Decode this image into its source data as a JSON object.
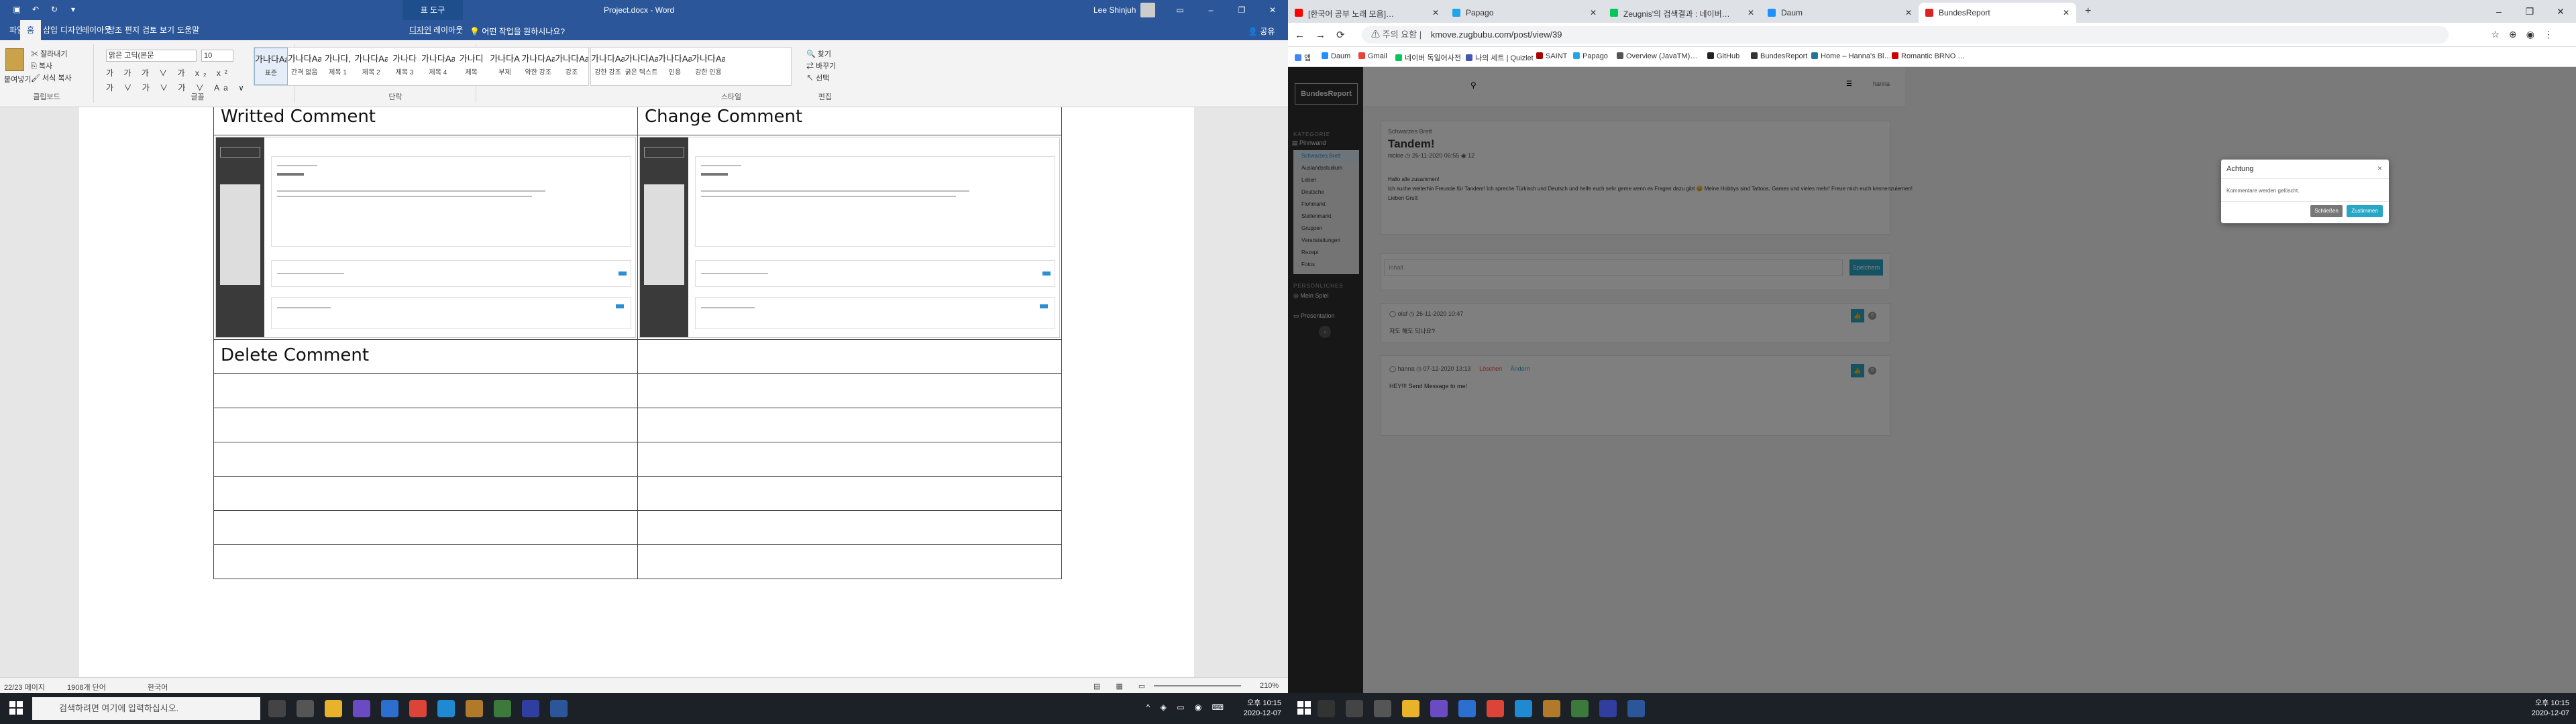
{
  "word": {
    "title": {
      "context_tab": "표 도구",
      "doc_title": "Project.docx  -  Word",
      "user": "Lee Shinjuh"
    },
    "menu_tabs": [
      "파일",
      "홈",
      "삽입",
      "디자인",
      "레이아웃",
      "참조",
      "편지",
      "검토",
      "보기",
      "도움말",
      "디자인",
      "레이아웃"
    ],
    "tell_me": "어떤 작업을 원하시나요?",
    "share": "공유",
    "ribbon": {
      "clipboard": {
        "paste": "붙여넣기",
        "cut": "잘라내기",
        "copy": "복사",
        "format_painter": "서식 복사",
        "label": "클립보드"
      },
      "font": {
        "name": "맑은 고딕(본문",
        "size": "10",
        "label": "글꼴",
        "row1": "가 가 가 ∨ 가 x₂ x²",
        "row2": "가 ∨ 가 ∨ 가 ∨ Aa ∨"
      },
      "paragraph": {
        "label": "단락"
      },
      "styles": {
        "label": "스타일",
        "items": [
          {
            "sample": "가나다AaI",
            "name": "표준"
          },
          {
            "sample": "가나다AaI",
            "name": "간격 없음"
          },
          {
            "sample": "가나다,",
            "name": "제목 1"
          },
          {
            "sample": "가나다AaI",
            "name": "제목 2"
          },
          {
            "sample": "가나다",
            "name": "제목 3"
          },
          {
            "sample": "가나다AaI",
            "name": "제목 4"
          },
          {
            "sample": "가나디",
            "name": "제목"
          },
          {
            "sample": "가나다A",
            "name": "부제"
          },
          {
            "sample": "가나다AaI",
            "name": "약한 강조"
          },
          {
            "sample": "가나다AaI",
            "name": "강조"
          },
          {
            "sample": "가나다AaI",
            "name": "강한 강조"
          },
          {
            "sample": "가나다AaI",
            "name": "굵은 텍스트"
          },
          {
            "sample": "가나다AaI",
            "name": "인용"
          },
          {
            "sample": "가나다AaI",
            "name": "강한 인용"
          }
        ]
      },
      "editing": {
        "find": "찾기",
        "replace": "바꾸기",
        "select": "선택",
        "label": "편집"
      }
    },
    "table": {
      "r1c1": "Writted Comment",
      "r1c2": "Change Comment",
      "r3c1": "Delete Comment"
    },
    "status": {
      "page": "22/23 페이지",
      "words": "1908개 단어",
      "lang": "한국어",
      "zoom": "210%"
    }
  },
  "taskbar": {
    "search_placeholder": "검색하려면 여기에 입력하십시오.",
    "time_left": "오후 10:15",
    "date_left": "2020-12-07",
    "time_right": "오후 10:15",
    "date_right": "2020-12-07"
  },
  "chrome": {
    "tabs": [
      "[한국어 공부 노래 모음]…",
      "Papago",
      "Zeugnis'의 검색결과 : 네이버…",
      "Daum",
      "BundesReport"
    ],
    "security": "주의 요함",
    "url": "kmove.zugbubu.com/post/view/39",
    "bookmarks": [
      "앱",
      "Daum",
      "Gmail",
      "네이버 독일어사전",
      "나의 세트 | Quizlet",
      "SAINT",
      "Papago",
      "Overview (JavaTM)…",
      "GitHub",
      "BundesReport",
      "Home – Hanna's Bl…",
      "Romantic BRNO …"
    ]
  },
  "site": {
    "logo": "BundesReport",
    "sec1": "KATEGORIE",
    "pinnwand": "Pinnwand",
    "sub": [
      "Schwarzes Brett",
      "Auslandsstudium",
      "Leben",
      "Deutsche",
      "Flohmarkt",
      "Stellenmarkt",
      "Gruppen",
      "Veranstaltungen",
      "Rezept",
      "Fotos"
    ],
    "sec2": "PERSÖNLICHES",
    "mein": "Mein Spiel",
    "presentation": "Presentation",
    "user_menu": "hanna",
    "post": {
      "category": "Schwarzes Brett",
      "title": "Tandem!",
      "author": "nickie",
      "date": "26-11-2020 06:55",
      "views": "12",
      "body1": "Hallo alle zusammen!",
      "body2": "Ich suche weiterhin Freunde für Tandem! Ich spreche Türkisch und Deutsch und helfe euch sehr gerne wenn es Fragen dazu gibt 😊 Meine Hobbys sind Tattoos, Games und vieles mehr! Freue mich euch kennenzulernen!",
      "body3": "Lieben Gruß"
    },
    "comment_placeholder": "Inhalt",
    "save": "Speichern",
    "comments": [
      {
        "author": "olaf",
        "date": "26-11-2020 10:47",
        "text": "저도 해도 되나요?",
        "likes": "0"
      },
      {
        "author": "hanna",
        "date": "07-12-2020 13:13",
        "delete": "Löschen",
        "edit": "Ändern",
        "text": "HEY!!! Send Message to me!",
        "likes": "0"
      }
    ]
  },
  "modal": {
    "title": "Achtung",
    "body": "Kommentare werden gelöscht.",
    "close": "Schließen",
    "confirm": "Zustimmen"
  },
  "colors": {
    "word_blue": "#2b579a",
    "accent_teal": "#2aa6c5",
    "link_red": "#e74c3c"
  }
}
